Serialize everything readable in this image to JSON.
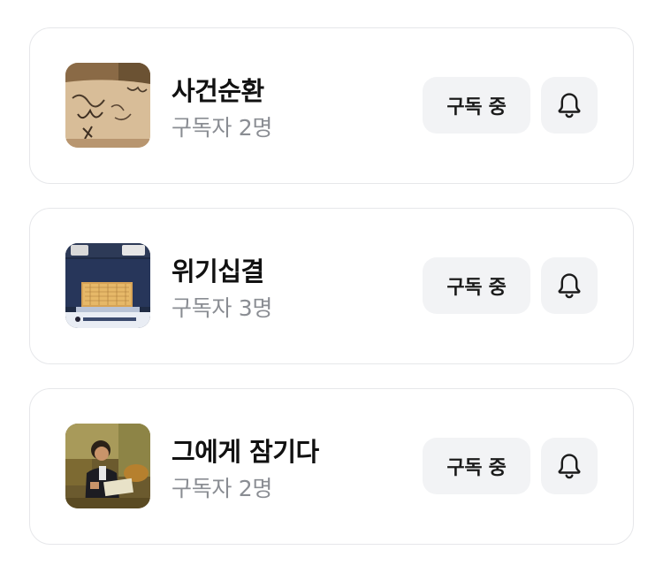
{
  "subscriptions": [
    {
      "title": "사건순환",
      "subscribers": "구독자 2명",
      "subscribe_label": "구독 중",
      "thumbnail": "handwritten-notes-thumbnail",
      "bell_icon": "bell-icon"
    },
    {
      "title": "위기십결",
      "subscribers": "구독자 3명",
      "subscribe_label": "구독 중",
      "thumbnail": "go-board-tournament-thumbnail",
      "bell_icon": "bell-icon"
    },
    {
      "title": "그에게 잠기다",
      "subscribers": "구독자 2명",
      "subscribe_label": "구독 중",
      "thumbnail": "man-reading-thumbnail",
      "bell_icon": "bell-icon"
    }
  ],
  "colors": {
    "card_border": "#e6e7ea",
    "button_bg": "#f2f3f5",
    "title_text": "#111111",
    "secondary_text": "#8a8d93"
  }
}
